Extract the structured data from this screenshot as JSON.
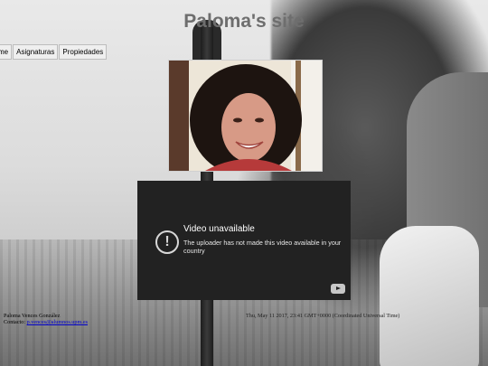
{
  "site": {
    "title": "Paloma's site"
  },
  "menu": {
    "items": [
      "me",
      "Asignaturas",
      "Propiedades"
    ]
  },
  "video": {
    "title": "Video unavailable",
    "message": "The uploader has not made this video available in your country"
  },
  "footer": {
    "name": "Paloma Vences González",
    "contact_label": "Contacto:",
    "contact_email": "p.vences@alumnos.upm.es",
    "timestamp": "Thu, May 11 2017, 23:41 GMT+0000 (Coordinated Universal Time)"
  },
  "icons": {
    "warning": "alert-circle-icon",
    "youtube": "youtube-logo-icon"
  }
}
